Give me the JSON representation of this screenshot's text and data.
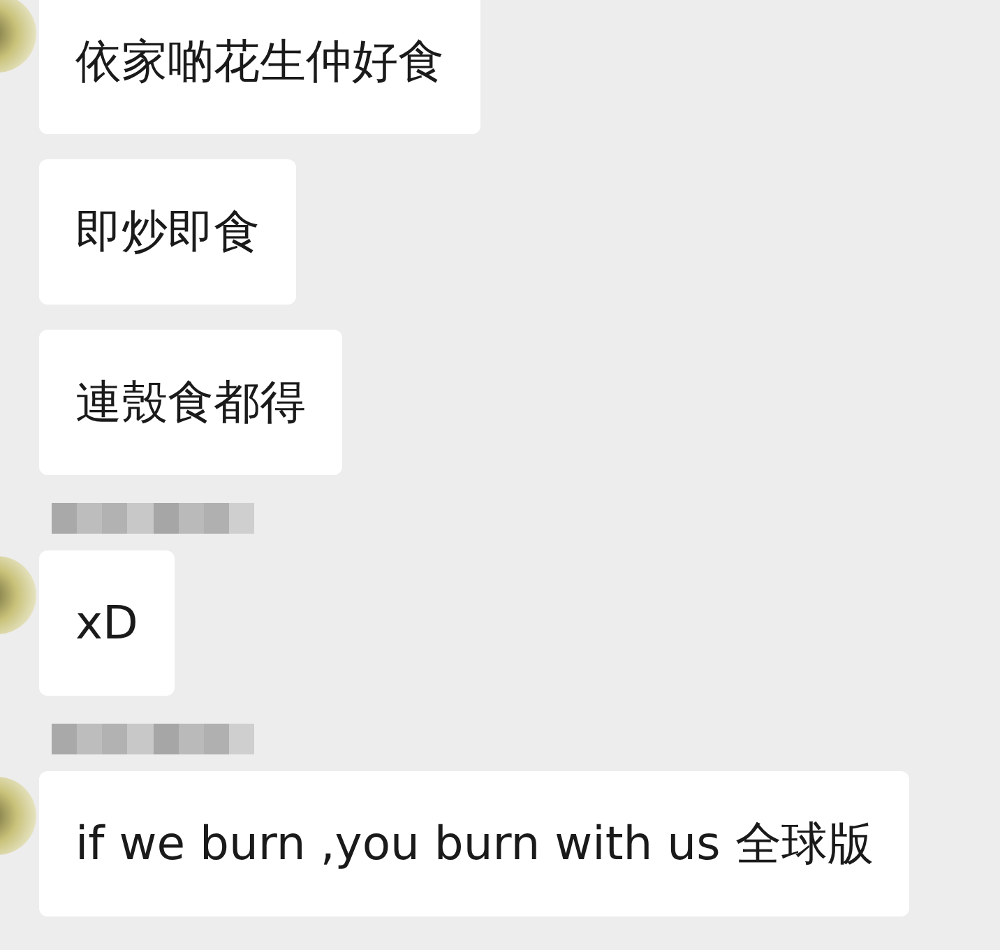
{
  "messages": [
    {
      "text": "依家啲花生仲好食",
      "sender_hidden": false,
      "avatar": true
    },
    {
      "text": "即炒即食",
      "sender_hidden": false,
      "avatar": false
    },
    {
      "text": "連殼食都得",
      "sender_hidden": false,
      "avatar": false
    },
    {
      "text": "xD",
      "sender_hidden": true,
      "avatar": true
    },
    {
      "text": "if we burn ,you burn with us 全球版",
      "sender_hidden": true,
      "avatar": true
    }
  ]
}
